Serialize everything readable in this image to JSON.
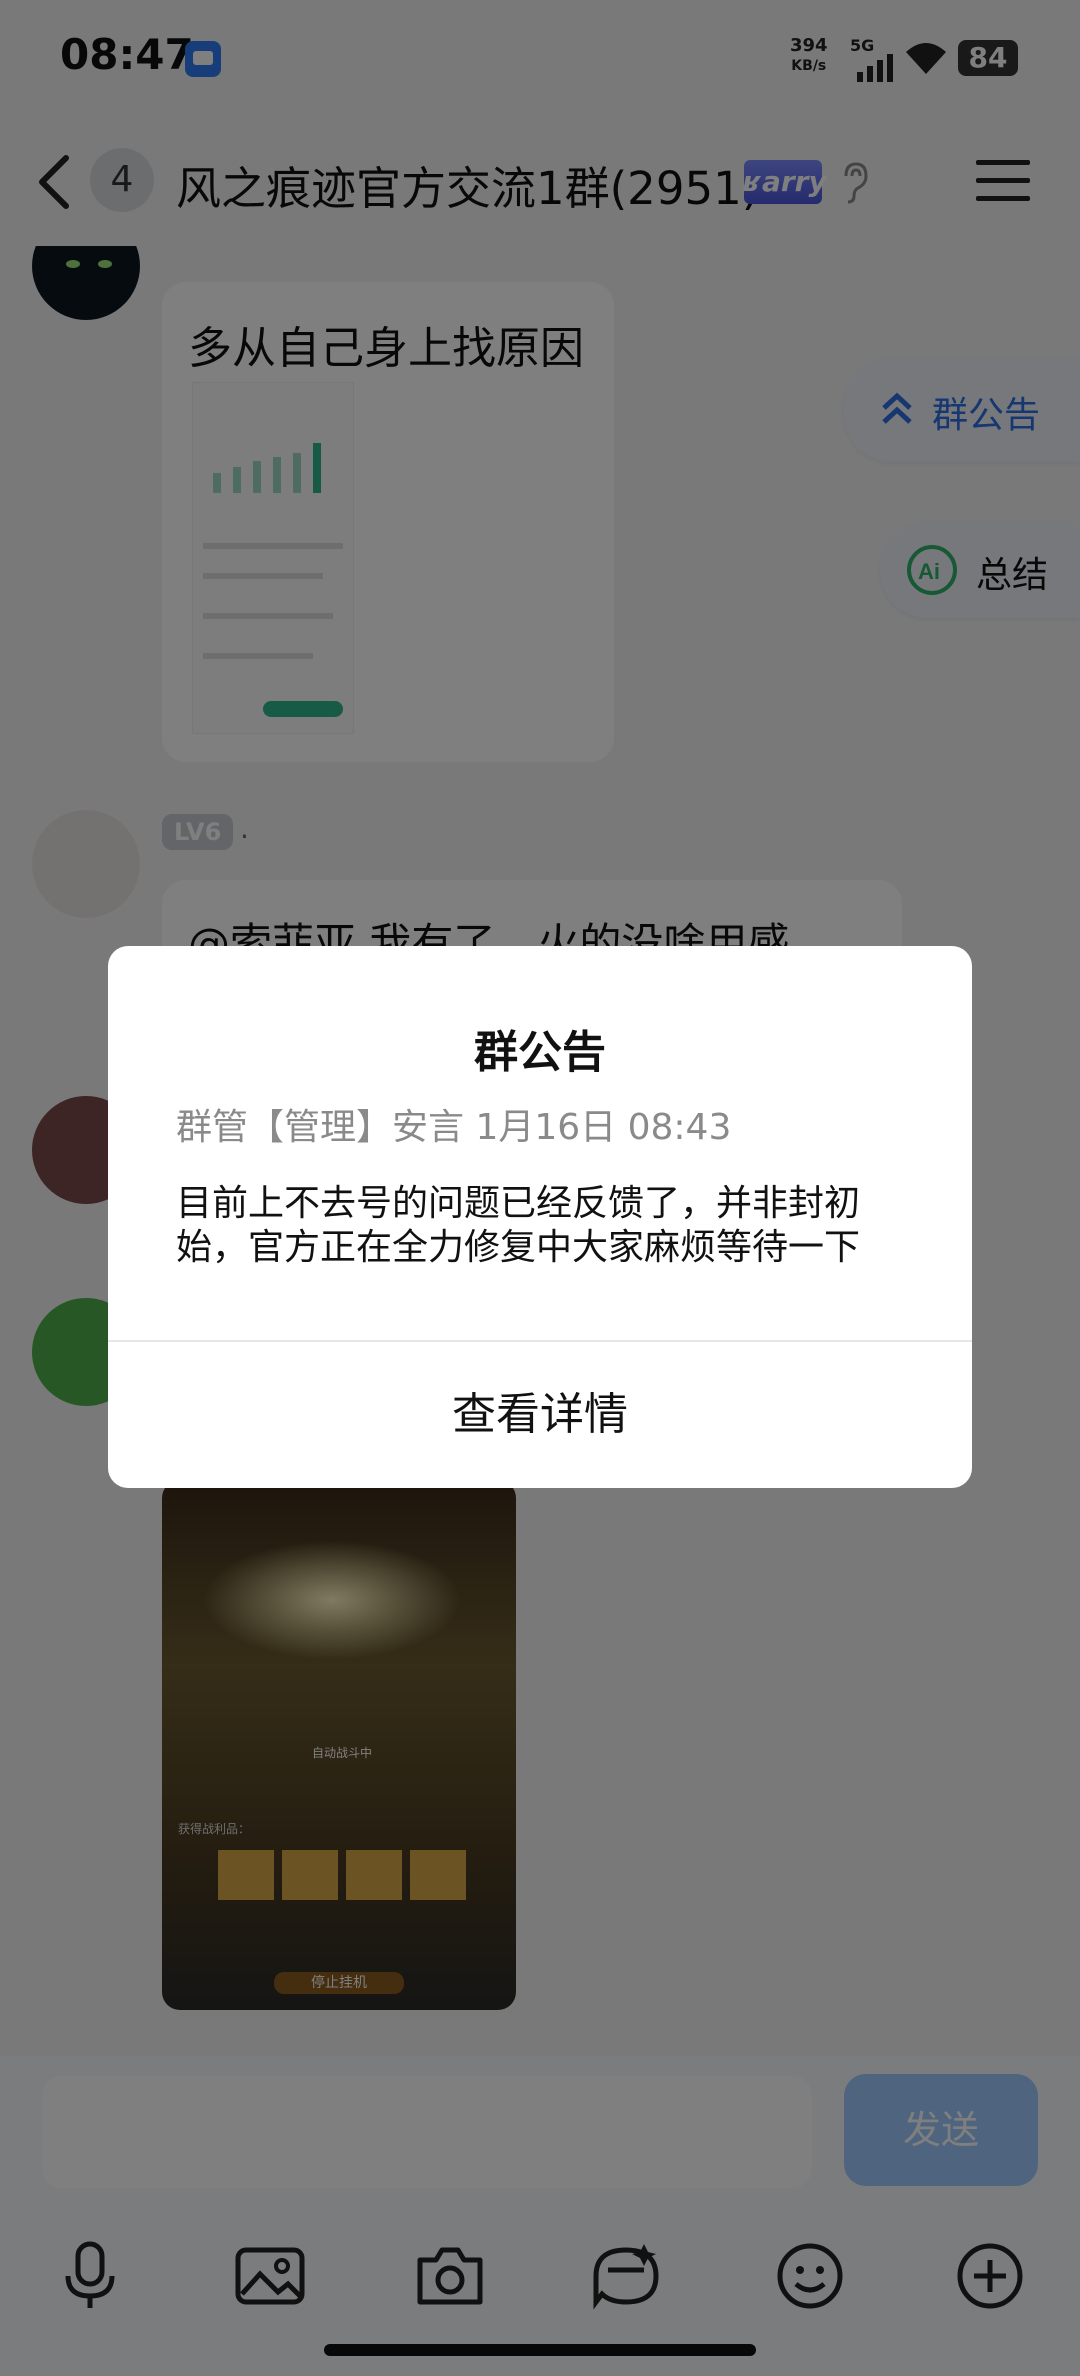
{
  "status_bar": {
    "time": "08:47",
    "speed_value": "394",
    "speed_unit": "KB/s",
    "network": "5G",
    "battery": "84"
  },
  "header": {
    "unread_count": "4",
    "title": "风之痕迹官方交流1群(2951)",
    "badge": "ʁarry"
  },
  "chat": {
    "message1": {
      "text": "多从自己身上找原因"
    },
    "message2": {
      "level": "LV6",
      "name": ".",
      "text": "@索菲亚 我有了，火的没啥用感"
    },
    "floating": {
      "announcement": "群公告",
      "summary": "总结"
    },
    "game_shot": {
      "loot_label": "获得战利品：",
      "auto_label": "自动战斗中",
      "button": "停止挂机"
    }
  },
  "input": {
    "send_label": "发送"
  },
  "dialog": {
    "title": "群公告",
    "meta": "群管【管理】安言 1月16日 08:43",
    "body": "目前上不去号的问题已经反馈了，并非封初始，官方正在全力修复中大家麻烦等待一下",
    "button": "查看详情"
  },
  "colors": {
    "accent": "#2f6ee0",
    "send_button": "#9cc8ff",
    "overlay": "rgba(0,0,0,0.5)"
  }
}
